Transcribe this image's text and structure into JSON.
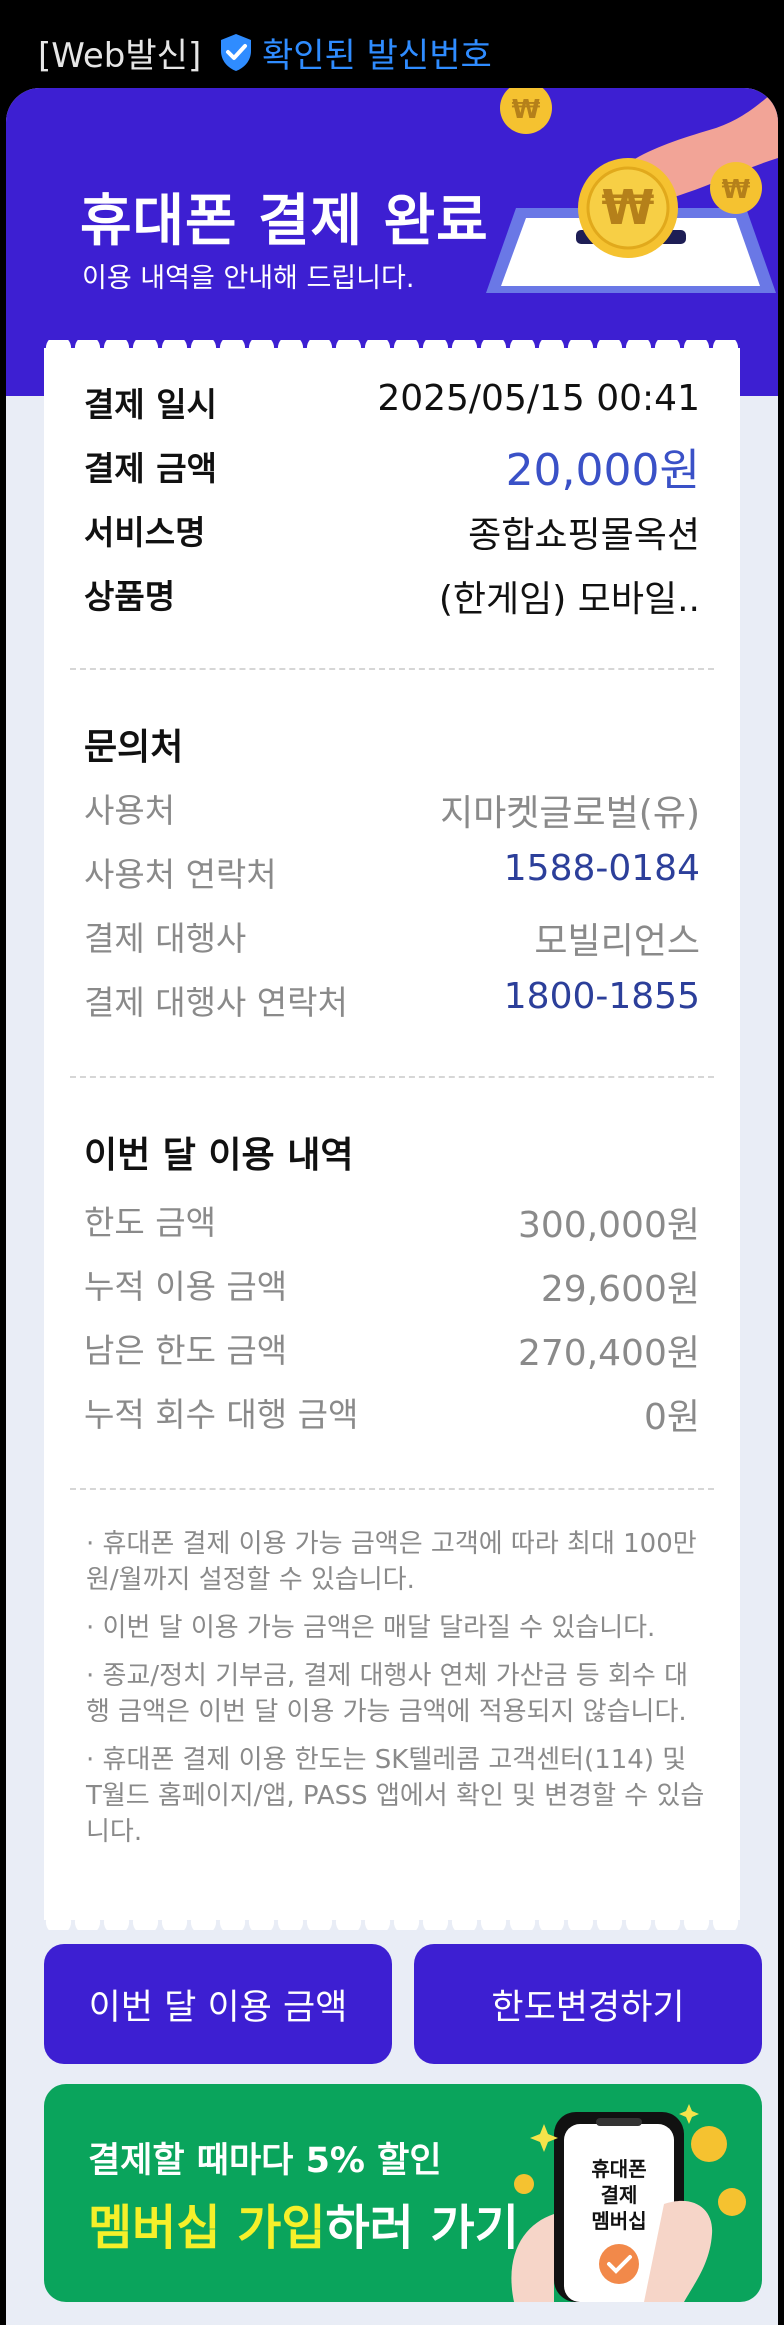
{
  "sender": {
    "tag": "[Web발신]",
    "verified_label": "확인된 발신번호",
    "verified_icon": "shield-check-icon",
    "verified_color": "#2f8cff"
  },
  "hero": {
    "title": "휴대폰 결제 완료",
    "subtitle": "이용 내역을 안내해 드립니다.",
    "bg_color": "#3d1fd2"
  },
  "payment": {
    "date_label": "결제 일시",
    "date_value": "2025/05/15 00:41",
    "amount_label": "결제 금액",
    "amount_value": "20,000원",
    "service_label": "서비스명",
    "service_value": "종합쇼핑몰옥션",
    "product_label": "상품명",
    "product_value": "(한게임) 모바일.."
  },
  "contact": {
    "title": "문의처",
    "merchant_label": "사용처",
    "merchant_value": "지마켓글로벌(유)",
    "merchant_phone_label": "사용처 연락처",
    "merchant_phone_value": "1588-0184",
    "agency_label": "결제 대행사",
    "agency_value": "모빌리언스",
    "agency_phone_label": "결제 대행사 연락처",
    "agency_phone_value": "1800-1855"
  },
  "usage": {
    "title": "이번 달 이용 내역",
    "limit_label": "한도 금액",
    "limit_value": "300,000원",
    "used_label": "누적 이용 금액",
    "used_value": "29,600원",
    "remaining_label": "남은 한도 금액",
    "remaining_value": "270,400원",
    "collect_label": "누적 회수 대행 금액",
    "collect_value": "0원"
  },
  "notes": [
    "· 휴대폰 결제 이용 가능 금액은 고객에 따라 최대 100만원/월까지 설정할 수 있습니다.",
    "· 이번 달 이용 가능 금액은 매달 달라질 수 있습니다.",
    "· 종교/정치 기부금, 결제 대행사 연체 가산금 등 회수 대행 금액은 이번 달 이용 가능 금액에 적용되지 않습니다.",
    "· 휴대폰 결제 이용 한도는 SK텔레콤 고객센터(114) 및 T월드 홈페이지/앱, PASS 앱에서 확인 및 변경할 수 있습니다."
  ],
  "buttons": {
    "monthly_usage": "이번 달 이용 금액",
    "change_limit": "한도변경하기"
  },
  "promo": {
    "line1": "결제할 때마다 5% 할인",
    "line2_highlight": "멤버십 가입",
    "line2_rest": "하러 가기",
    "phone_line1": "휴대폰",
    "phone_line2": "결제",
    "phone_line3": "멤버십",
    "highlight_color": "#f5f02a",
    "bg_color": "#0aa45c"
  }
}
